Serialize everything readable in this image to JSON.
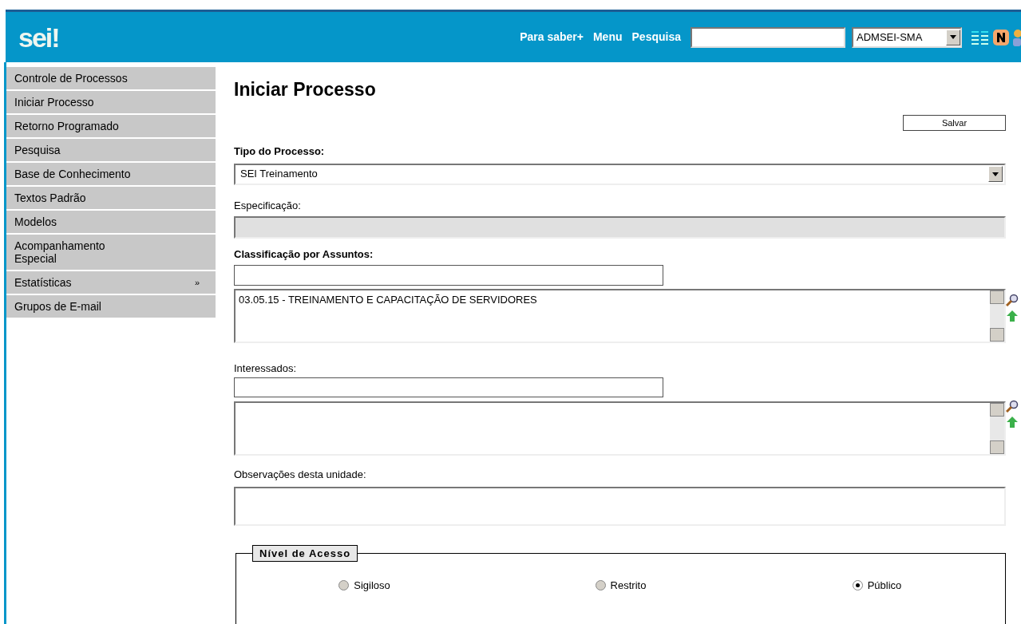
{
  "header": {
    "logo": "sei!",
    "links": [
      "Para saber+",
      "Menu",
      "Pesquisa"
    ],
    "unit_select": {
      "value": "ADMSEI-SMA"
    }
  },
  "sidebar": {
    "items": [
      {
        "label": "Controle de Processos"
      },
      {
        "label": "Iniciar Processo"
      },
      {
        "label": "Retorno Programado"
      },
      {
        "label": "Pesquisa"
      },
      {
        "label": "Base de Conhecimento"
      },
      {
        "label": "Textos Padrão"
      },
      {
        "label": "Modelos"
      },
      {
        "label": "Acompanhamento Especial"
      },
      {
        "label": "Estatísticas",
        "arrow": "»"
      },
      {
        "label": "Grupos de E-mail"
      }
    ]
  },
  "page": {
    "title": "Iniciar Processo",
    "save_button": "Salvar",
    "tipo": {
      "label": "Tipo do Processo:",
      "value": "SEI Treinamento"
    },
    "especificacao": {
      "label": "Especificação:",
      "disabled": true
    },
    "classificacao": {
      "label": "Classificação por Assuntos:",
      "items": [
        "03.05.15 - TREINAMENTO E CAPACITAÇÃO DE SERVIDORES"
      ]
    },
    "interessados": {
      "label": "Interessados:"
    },
    "observacoes": {
      "label": "Observações desta unidade:"
    },
    "nivel_acesso": {
      "legend": "Nível de Acesso",
      "options": [
        {
          "label": "Sigiloso",
          "selected": false
        },
        {
          "label": "Restrito",
          "selected": false
        },
        {
          "label": "Público",
          "selected": true
        }
      ]
    }
  }
}
